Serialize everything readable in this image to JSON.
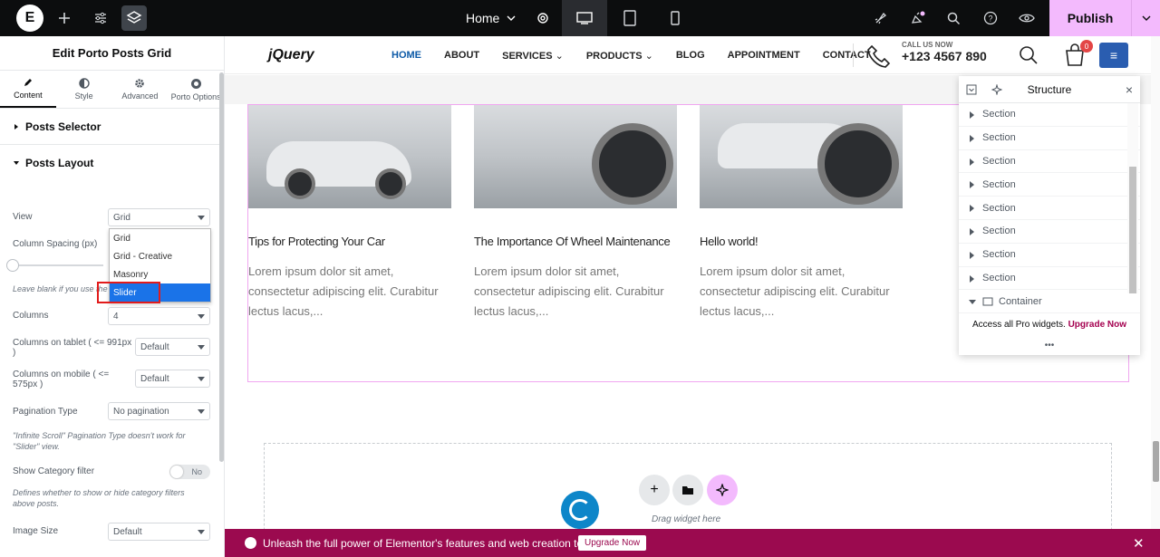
{
  "topbar": {
    "page_name": "Home",
    "publish_label": "Publish",
    "devices": [
      "desktop-icon",
      "tablet-icon",
      "mobile-icon"
    ]
  },
  "panel": {
    "title": "Edit Porto Posts Grid",
    "tabs": [
      {
        "label": "Content",
        "icon": "pencil-icon",
        "active": true
      },
      {
        "label": "Style",
        "icon": "half-circle-icon",
        "active": false
      },
      {
        "label": "Advanced",
        "icon": "gear-icon",
        "active": false
      },
      {
        "label": "Porto Options",
        "icon": "porto-icon",
        "active": false
      }
    ],
    "sections": {
      "posts_selector": "Posts Selector",
      "posts_layout": "Posts Layout"
    },
    "controls": {
      "view_label": "View",
      "view_value": "Grid",
      "view_options": [
        "Grid",
        "Grid - Creative",
        "Masonry",
        "Slider"
      ],
      "view_highlighted": "Slider",
      "column_spacing_label": "Column Spacing (px)",
      "column_spacing_help": "Leave blank if you use the",
      "columns_label": "Columns",
      "columns_value": "4",
      "columns_tablet_label": "Columns on tablet ( <= 991px )",
      "columns_tablet_value": "Default",
      "columns_mobile_label": "Columns on mobile ( <= 575px )",
      "columns_mobile_value": "Default",
      "pagination_label": "Pagination Type",
      "pagination_value": "No pagination",
      "pagination_help": "\"Infinite Scroll\" Pagination Type doesn't work for \"Slider\" view.",
      "category_filter_label": "Show Category filter",
      "category_filter_value": "No",
      "category_filter_help": "Defines whether to show or hide category filters above posts.",
      "image_size_label": "Image Size",
      "image_size_value": "Default"
    }
  },
  "site": {
    "logo": "jQuery",
    "nav": [
      "HOME",
      "ABOUT",
      "SERVICES",
      "PRODUCTS",
      "BLOG",
      "APPOINTMENT",
      "CONTACT"
    ],
    "call_small": "CALL US NOW",
    "call_number": "+123 4567 890",
    "cart_count": "0"
  },
  "posts": [
    {
      "title": "Tips for Protecting Your Car",
      "excerpt": "Lorem ipsum dolor sit amet, consectetur adipiscing elit. Curabitur lectus lacus,..."
    },
    {
      "title": "The Importance Of Wheel Maintenance",
      "excerpt": "Lorem ipsum dolor sit amet, consectetur adipiscing elit. Curabitur lectus lacus,..."
    },
    {
      "title": "Hello world!",
      "excerpt": "Lorem ipsum dolor sit amet, consectetur adipiscing elit. Curabitur lectus lacus,..."
    }
  ],
  "dropzone": {
    "text": "Drag widget here"
  },
  "structure": {
    "title": "Structure",
    "rows": [
      "Section",
      "Section",
      "Section",
      "Section",
      "Section",
      "Section",
      "Section",
      "Section"
    ],
    "container_label": "Container",
    "pro_text": "Access all Pro widgets.",
    "pro_link": "Upgrade Now"
  },
  "promo": {
    "text": "Unleash the full power of Elementor's features and web creation tools.",
    "button": "Upgrade Now"
  },
  "colors": {
    "accent": "#f3bafd",
    "promo_bg": "#9b0a4f",
    "nav_active": "#0d5aa7",
    "selection": "#1a73e8"
  }
}
